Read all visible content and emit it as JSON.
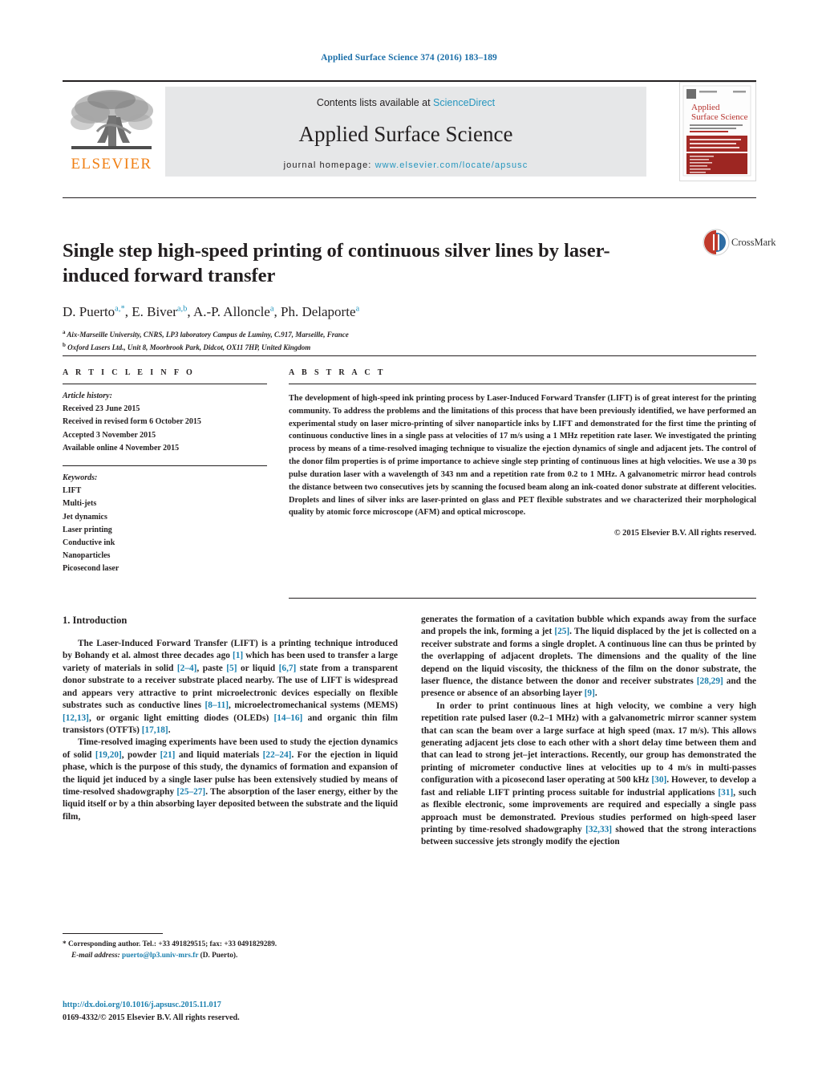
{
  "running_head": "Applied Surface Science 374 (2016) 183–189",
  "masthead": {
    "publisher_logo_text": "ELSEVIER",
    "contents_prefix": "Contents lists available at ",
    "contents_link": "ScienceDirect",
    "journal_name": "Applied Surface Science",
    "homepage_prefix": "journal homepage: ",
    "homepage_url": "www.elsevier.com/locate/apsusc",
    "cover_journal_title_line1": "Applied",
    "cover_journal_title_line2": "Surface Science"
  },
  "badge": {
    "crossmark_label": "CrossMark"
  },
  "article": {
    "title": "Single step high-speed printing of continuous silver lines by laser-induced forward transfer",
    "authors_html": "D. Puerto<sup>a,*</sup>, E. Biver<sup>a,b</sup>, A.-P. Alloncle<sup>a</sup>, Ph. Delaporte<sup>a</sup>",
    "affiliations": [
      {
        "marker": "a",
        "text": "Aix-Marseille University, CNRS, LP3 laboratory Campus de Luminy, C.917, Marseille, France"
      },
      {
        "marker": "b",
        "text": "Oxford Lasers Ltd., Unit 8, Moorbrook Park, Didcot, OX11 7HP, United Kingdom"
      }
    ]
  },
  "article_info": {
    "heading": "A R T I C L E    I N F O",
    "history_label": "Article history:",
    "history": [
      "Received 23 June 2015",
      "Received in revised form 6 October 2015",
      "Accepted 3 November 2015",
      "Available online 4 November 2015"
    ],
    "keywords_label": "Keywords:",
    "keywords": [
      "LIFT",
      "Multi-jets",
      "Jet dynamics",
      "Laser printing",
      "Conductive ink",
      "Nanoparticles",
      "Picosecond laser"
    ]
  },
  "abstract": {
    "heading": "A B S T R A C T",
    "text": "The development of high-speed ink printing process by Laser-Induced Forward Transfer (LIFT) is of great interest for the printing community. To address the problems and the limitations of this process that have been previously identified, we have performed an experimental study on laser micro-printing of silver nanoparticle inks by LIFT and demonstrated for the first time the printing of continuous conductive lines in a single pass at velocities of 17 m/s using a 1 MHz repetition rate laser. We investigated the printing process by means of a time-resolved imaging technique to visualize the ejection dynamics of single and adjacent jets. The control of the donor film properties is of prime importance to achieve single step printing of continuous lines at high velocities. We use a 30 ps pulse duration laser with a wavelength of 343 nm and a repetition rate from 0.2 to 1 MHz. A galvanometric mirror head controls the distance between two consecutives jets by scanning the focused beam along an ink-coated donor substrate at different velocities. Droplets and lines of silver inks are laser-printed on glass and PET flexible substrates and we characterized their morphological quality by atomic force microscope (AFM) and optical microscope.",
    "copyright": "© 2015 Elsevier B.V. All rights reserved."
  },
  "body": {
    "section_heading": "1.  Introduction",
    "left_paragraphs": [
      "The Laser-Induced Forward Transfer (LIFT) is a printing technique introduced by Bohandy et al. almost three decades ago <span class=\"ref\">[1]</span> which has been used to transfer a large variety of materials in solid <span class=\"ref\">[2–4]</span>, paste <span class=\"ref\">[5]</span> or liquid <span class=\"ref\">[6,7]</span> state from a transparent donor substrate to a receiver substrate placed nearby. The use of LIFT is widespread and appears very attractive to print microelectronic devices especially on flexible substrates such as conductive lines <span class=\"ref\">[8–11]</span>, microelectromechanical systems (MEMS) <span class=\"ref\">[12,13]</span>, or organic light emitting diodes (OLEDs) <span class=\"ref\">[14–16]</span> and organic thin film transistors (OTFTs) <span class=\"ref\">[17,18]</span>.",
      "Time-resolved imaging experiments have been used to study the ejection dynamics of solid <span class=\"ref\">[19,20]</span>, powder <span class=\"ref\">[21]</span> and liquid materials <span class=\"ref\">[22–24]</span>. For the ejection in liquid phase, which is the purpose of this study, the dynamics of formation and expansion of the liquid jet induced by a single laser pulse has been extensively studied by means of time-resolved shadowgraphy <span class=\"ref\">[25–27]</span>. The absorption of the laser energy, either by the liquid itself or by a thin absorbing layer deposited between the substrate and the liquid film,"
    ],
    "right_paragraphs": [
      "generates the formation of a cavitation bubble which expands away from the surface and propels the ink, forming a jet <span class=\"ref\">[25]</span>. The liquid displaced by the jet is collected on a receiver substrate and forms a single droplet. A continuous line can thus be printed by the overlapping of adjacent droplets. The dimensions and the quality of the line depend on the liquid viscosity, the thickness of the film on the donor substrate, the laser fluence, the distance between the donor and receiver substrates <span class=\"ref\">[28,29]</span> and the presence or absence of an absorbing layer <span class=\"ref\">[9]</span>.",
      "In order to print continuous lines at high velocity, we combine a very high repetition rate pulsed laser (0.2–1 MHz) with a galvanometric mirror scanner system that can scan the beam over a large surface at high speed (max. 17 m/s). This allows generating adjacent jets close to each other with a short delay time between them and that can lead to strong jet–jet interactions. Recently, our group has demonstrated the printing of micrometer conductive lines at velocities up to 4 m/s in multi-passes configuration with a picosecond laser operating at 500 kHz <span class=\"ref\">[30]</span>. However, to develop a fast and reliable LIFT printing process suitable for industrial applications <span class=\"ref\">[31]</span>, such as flexible electronic, some improvements are required and especially a single pass approach must be demonstrated. Previous studies performed on high-speed laser printing by time-resolved shadowgraphy <span class=\"ref\">[32,33]</span> showed that the strong interactions between successive jets strongly modify the ejection"
    ]
  },
  "footnotes": {
    "corresponding": "* Corresponding author. Tel.: +33 491829515; fax: +33 0491829289.",
    "email_label": "E-mail address:",
    "email": "puerto@lp3.univ-mrs.fr",
    "email_suffix": "(D. Puerto).",
    "doi": "http://dx.doi.org/10.1016/j.apsusc.2015.11.017",
    "issn_line": "0169-4332/© 2015 Elsevier B.V. All rights reserved."
  },
  "colors": {
    "link": "#1a7fae",
    "sciencedirect": "#2596be",
    "elsevier_orange": "#f07f13",
    "band_gray": "#e6e7e8"
  }
}
